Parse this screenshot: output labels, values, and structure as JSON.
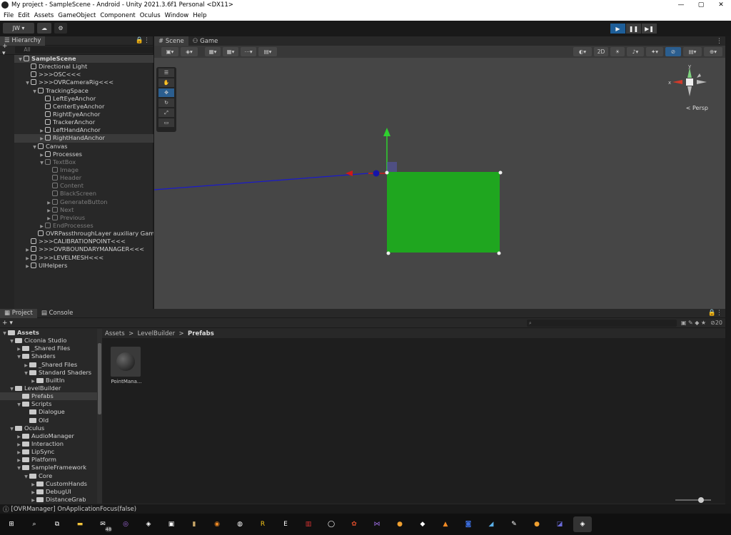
{
  "window": {
    "title": "My project - SampleScene - Android - Unity 2021.3.6f1 Personal <DX11>",
    "controls": [
      "—",
      "▢",
      "✕"
    ]
  },
  "menu": [
    "File",
    "Edit",
    "Assets",
    "GameObject",
    "Component",
    "Oculus",
    "Window",
    "Help"
  ],
  "toolbar": {
    "account": "JW ▾",
    "cloud": "☁",
    "collab": "⚙"
  },
  "hierarchy": {
    "tab": "Hierarchy",
    "search_placeholder": "All",
    "add": "+ ▾",
    "items": [
      {
        "label": "SampleScene",
        "depth": 0,
        "arrow": "▼",
        "kind": "scene"
      },
      {
        "label": "Directional Light",
        "depth": 1,
        "arrow": ""
      },
      {
        "label": ">>>OSC<<<",
        "depth": 1,
        "arrow": ""
      },
      {
        "label": ">>>OVRCameraRig<<<",
        "depth": 1,
        "arrow": "▼"
      },
      {
        "label": "TrackingSpace",
        "depth": 2,
        "arrow": "▼"
      },
      {
        "label": "LeftEyeAnchor",
        "depth": 3,
        "arrow": ""
      },
      {
        "label": "CenterEyeAnchor",
        "depth": 3,
        "arrow": ""
      },
      {
        "label": "RightEyeAnchor",
        "depth": 3,
        "arrow": ""
      },
      {
        "label": "TrackerAnchor",
        "depth": 3,
        "arrow": ""
      },
      {
        "label": "LeftHandAnchor",
        "depth": 3,
        "arrow": "▶"
      },
      {
        "label": "RightHandAnchor",
        "depth": 3,
        "arrow": "▶",
        "selected": true
      },
      {
        "label": "Canvas",
        "depth": 2,
        "arrow": "▼"
      },
      {
        "label": "Processes",
        "depth": 3,
        "arrow": "▶"
      },
      {
        "label": "TextBox",
        "depth": 3,
        "arrow": "▼",
        "dim": true
      },
      {
        "label": "Image",
        "depth": 4,
        "arrow": "",
        "dim": true
      },
      {
        "label": "Header",
        "depth": 4,
        "arrow": "",
        "dim": true
      },
      {
        "label": "Content",
        "depth": 4,
        "arrow": "",
        "dim": true
      },
      {
        "label": "BlackScreen",
        "depth": 4,
        "arrow": "",
        "dim": true
      },
      {
        "label": "GenerateButton",
        "depth": 4,
        "arrow": "▶",
        "dim": true
      },
      {
        "label": "Next",
        "depth": 4,
        "arrow": "▶",
        "dim": true
      },
      {
        "label": "Previous",
        "depth": 4,
        "arrow": "▶",
        "dim": true
      },
      {
        "label": "EndProcesses",
        "depth": 3,
        "arrow": "▶",
        "dim": true
      },
      {
        "label": "OVRPassthroughLayer auxiliary GameO",
        "depth": 2,
        "arrow": ""
      },
      {
        "label": ">>>CALIBRATIONPOINT<<<",
        "depth": 1,
        "arrow": ""
      },
      {
        "label": ">>>OVRBOUNDARYMANAGER<<<",
        "depth": 1,
        "arrow": "▶"
      },
      {
        "label": ">>>LEVELMESH<<<",
        "depth": 1,
        "arrow": "▶"
      },
      {
        "label": "UIHelpers",
        "depth": 1,
        "arrow": "▶"
      }
    ]
  },
  "scene": {
    "tabs": [
      "Scene",
      "Game"
    ],
    "toolbar_left": [
      "▣▾",
      "◈▾",
      "▦▾",
      "▦▾",
      "⋯▾",
      "▤▾"
    ],
    "toolbar_right": [
      "◐▾",
      "2D",
      "☀",
      "♪▾",
      "✦▾",
      "⊘",
      "▤▾",
      "⊕▾"
    ],
    "tools": [
      "☰",
      "✋",
      "✥",
      "↻",
      "⤢",
      "▭",
      "⛭"
    ],
    "persp": "< Persp",
    "gizmo": {
      "y": "y",
      "x": "x"
    }
  },
  "project": {
    "tabs": [
      "Project",
      "Console"
    ],
    "add": "+ ▾",
    "breadcrumb": [
      "Assets",
      "LevelBuilder",
      "Prefabs"
    ],
    "search_placeholder": "",
    "count": "20",
    "tree": [
      {
        "label": "Assets",
        "depth": 0,
        "arrow": "▼",
        "bold": true
      },
      {
        "label": "Ciconia Studio",
        "depth": 1,
        "arrow": "▼"
      },
      {
        "label": "_Shared Files",
        "depth": 2,
        "arrow": "▶"
      },
      {
        "label": "Shaders",
        "depth": 2,
        "arrow": "▼"
      },
      {
        "label": "_Shared Files",
        "depth": 3,
        "arrow": "▶"
      },
      {
        "label": "Standard Shaders",
        "depth": 3,
        "arrow": "▼"
      },
      {
        "label": "BuiltIn",
        "depth": 4,
        "arrow": "▶"
      },
      {
        "label": "LevelBuilder",
        "depth": 1,
        "arrow": "▼"
      },
      {
        "label": "Prefabs",
        "depth": 2,
        "arrow": "",
        "selected": true
      },
      {
        "label": "Scripts",
        "depth": 2,
        "arrow": "▼"
      },
      {
        "label": "Dialogue",
        "depth": 3,
        "arrow": ""
      },
      {
        "label": "Old",
        "depth": 3,
        "arrow": ""
      },
      {
        "label": "Oculus",
        "depth": 1,
        "arrow": "▼"
      },
      {
        "label": "AudioManager",
        "depth": 2,
        "arrow": "▶"
      },
      {
        "label": "Interaction",
        "depth": 2,
        "arrow": "▶"
      },
      {
        "label": "LipSync",
        "depth": 2,
        "arrow": "▶"
      },
      {
        "label": "Platform",
        "depth": 2,
        "arrow": "▶"
      },
      {
        "label": "SampleFramework",
        "depth": 2,
        "arrow": "▼"
      },
      {
        "label": "Core",
        "depth": 3,
        "arrow": "▼"
      },
      {
        "label": "CustomHands",
        "depth": 4,
        "arrow": "▶"
      },
      {
        "label": "DebugUI",
        "depth": 4,
        "arrow": "▶"
      },
      {
        "label": "DistanceGrab",
        "depth": 4,
        "arrow": "▶"
      }
    ],
    "assets": [
      {
        "label": "PointMana..."
      }
    ]
  },
  "status": {
    "message": "[OVRManager] OnApplicationFocus(false)"
  },
  "taskbar": {
    "badge": "48"
  }
}
